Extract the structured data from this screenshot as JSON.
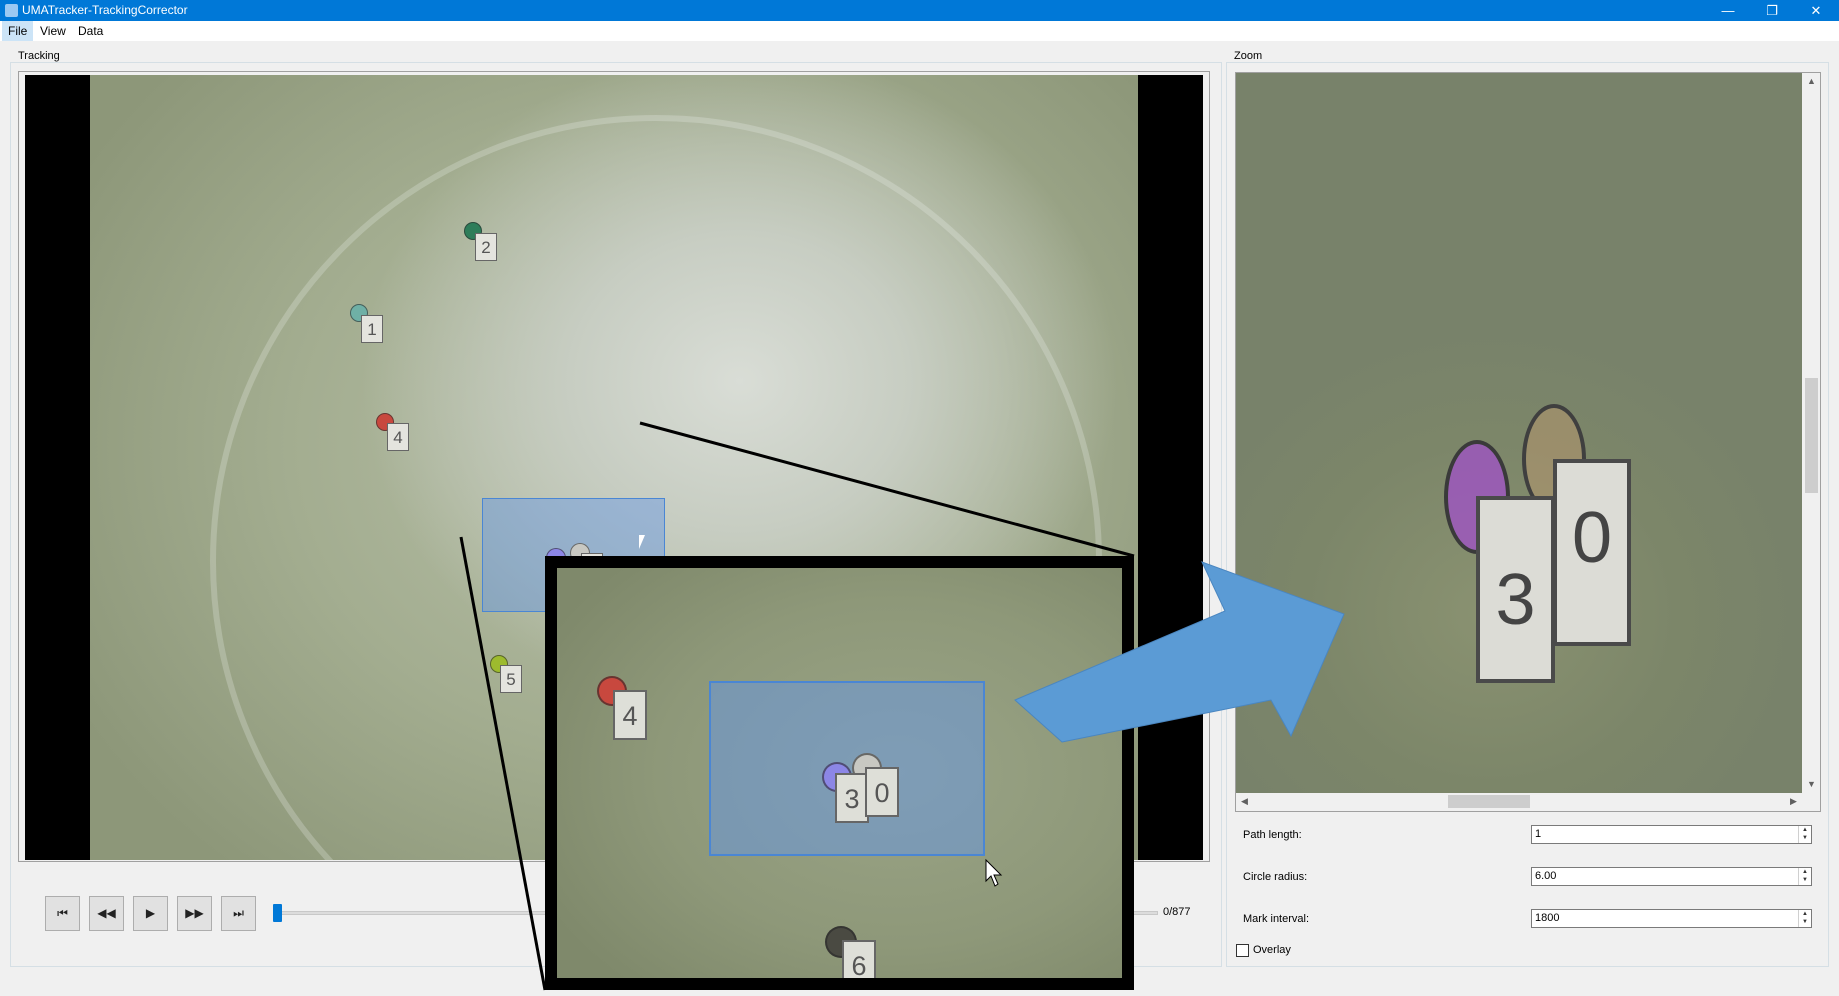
{
  "window": {
    "title": "UMATracker-TrackingCorrector",
    "minimize_glyph": "—",
    "maximize_glyph": "❐",
    "close_glyph": "✕"
  },
  "menu": {
    "items": [
      {
        "label": "File"
      },
      {
        "label": "View"
      },
      {
        "label": "Data"
      }
    ]
  },
  "tracking": {
    "group_label": "Tracking",
    "markers": [
      {
        "id": "2",
        "color": "#2e7d5a"
      },
      {
        "id": "1",
        "color": "#6fb0a6"
      },
      {
        "id": "4",
        "color": "#c8483e"
      },
      {
        "id": "3",
        "color": "#8c86e6"
      },
      {
        "id": "0",
        "color": "#c8c8c2"
      },
      {
        "id": "5",
        "color": "#9dbb2e"
      }
    ]
  },
  "playback": {
    "first_glyph": "⏮",
    "rewind_glyph": "◀◀",
    "play_glyph": "▶",
    "forward_glyph": "▶▶",
    "last_glyph": "⏭",
    "frame_counter": "0/877"
  },
  "zoom": {
    "group_label": "Zoom",
    "visible_markers": [
      {
        "id": "3",
        "color": "#9b59c8"
      },
      {
        "id": "0",
        "color": "#c9b07a"
      }
    ]
  },
  "settings": {
    "path_length": {
      "label": "Path length:",
      "value": "1"
    },
    "circle_radius": {
      "label": "Circle radius:",
      "value": "6.00"
    },
    "mark_interval": {
      "label": "Mark interval:",
      "value": "1800"
    },
    "overlay": {
      "label": "Overlay",
      "checked": false
    }
  },
  "callout": {
    "markers": [
      {
        "id": "4",
        "color": "#c8483e"
      },
      {
        "id": "3",
        "color": "#8c86e6"
      },
      {
        "id": "0",
        "color": "#c8c8c2"
      },
      {
        "id": "6",
        "color": "#4a4a42"
      }
    ],
    "arrow_color": "#5b9bd5"
  }
}
